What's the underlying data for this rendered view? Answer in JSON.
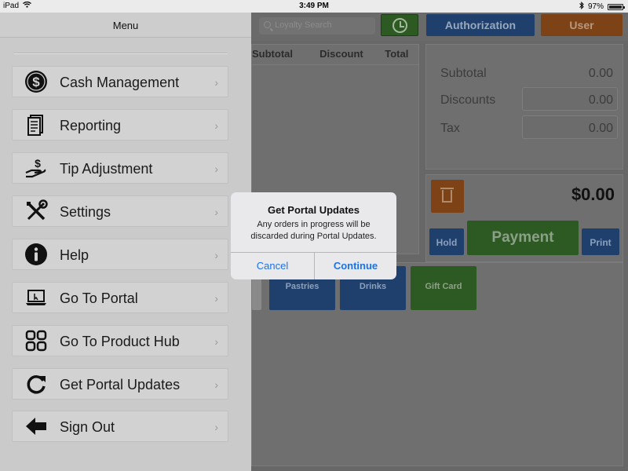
{
  "status_bar": {
    "device": "iPad",
    "time": "3:49 PM",
    "battery": "97%"
  },
  "app": {
    "loyalty_placeholder": "Loyalty Search",
    "authorization_label": "Authorization",
    "user_label": "User",
    "order_columns": [
      "Subtotal",
      "Discount",
      "Total"
    ],
    "totals": [
      {
        "label": "Subtotal",
        "value": "0.00"
      },
      {
        "label": "Discounts",
        "value": "0.00"
      },
      {
        "label": "Tax",
        "value": "0.00"
      }
    ],
    "amount": "$0.00",
    "hold_label": "Hold",
    "payment_label": "Payment",
    "print_label": "Print",
    "categories": [
      "Pastries",
      "Drinks",
      "Gift Card"
    ]
  },
  "menu": {
    "title": "Menu",
    "items": [
      {
        "label": "Cash Management",
        "icon": "dollar-icon"
      },
      {
        "label": "Reporting",
        "icon": "document-icon"
      },
      {
        "label": "Tip Adjustment",
        "icon": "hand-dollar-icon"
      },
      {
        "label": "Settings",
        "icon": "tools-icon"
      },
      {
        "label": "Help",
        "icon": "info-icon"
      },
      {
        "label": "Go To Portal",
        "icon": "laptop-icon"
      },
      {
        "label": "Go To Product Hub",
        "icon": "grid-icon"
      },
      {
        "label": "Get Portal Updates",
        "icon": "refresh-icon"
      },
      {
        "label": "Sign Out",
        "icon": "arrow-left-icon"
      }
    ]
  },
  "dialog": {
    "title": "Get Portal Updates",
    "message": "Any orders in progress will be discarded during Portal Updates.",
    "cancel_label": "Cancel",
    "continue_label": "Continue"
  },
  "colors": {
    "link_blue": "#1a73e8",
    "menu_background": "#cacaca",
    "dim_overlay": "#676767"
  }
}
